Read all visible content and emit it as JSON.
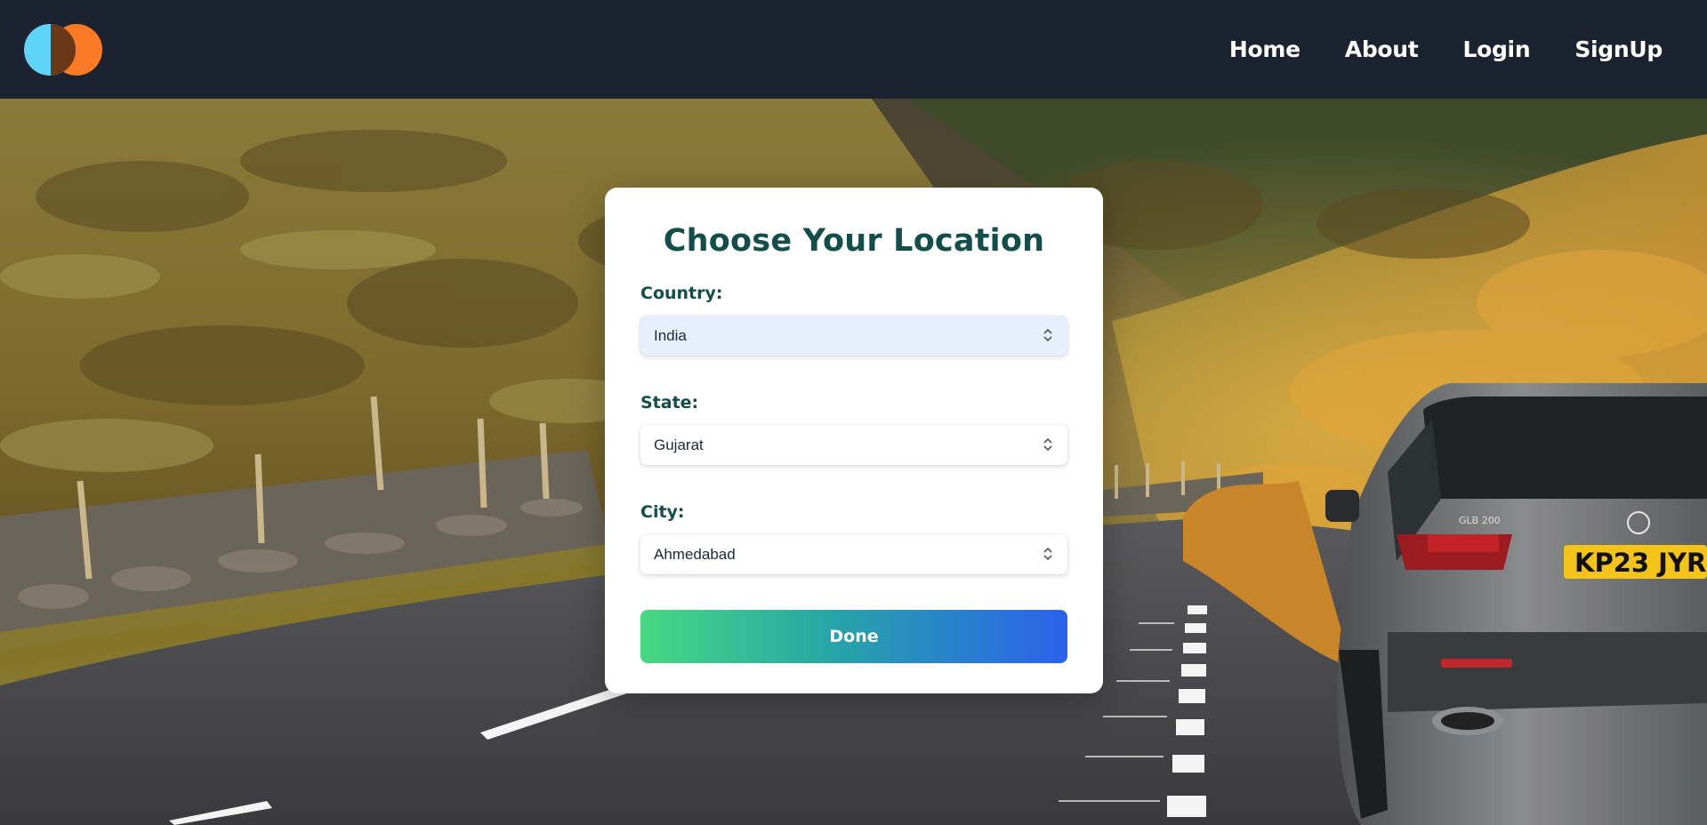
{
  "nav": {
    "logo_icon": "overlapping-circles-logo",
    "links": [
      "Home",
      "About",
      "Login",
      "SignUp"
    ]
  },
  "card": {
    "title": "Choose Your Location",
    "country": {
      "label": "Country:",
      "value": "India"
    },
    "state": {
      "label": "State:",
      "value": "Gujarat"
    },
    "city": {
      "label": "City:",
      "value": "Ahmedabad"
    },
    "done_label": "Done"
  },
  "scene": {
    "plate": "KP23 JYR",
    "badge": "GLB 200"
  },
  "colors": {
    "navbar": "#1b2230",
    "accent_text": "#134e4a",
    "logo_blue": "#5fd3f8",
    "logo_orange": "#fb7a25",
    "button_start": "#48d882",
    "button_end": "#2a61ec"
  }
}
